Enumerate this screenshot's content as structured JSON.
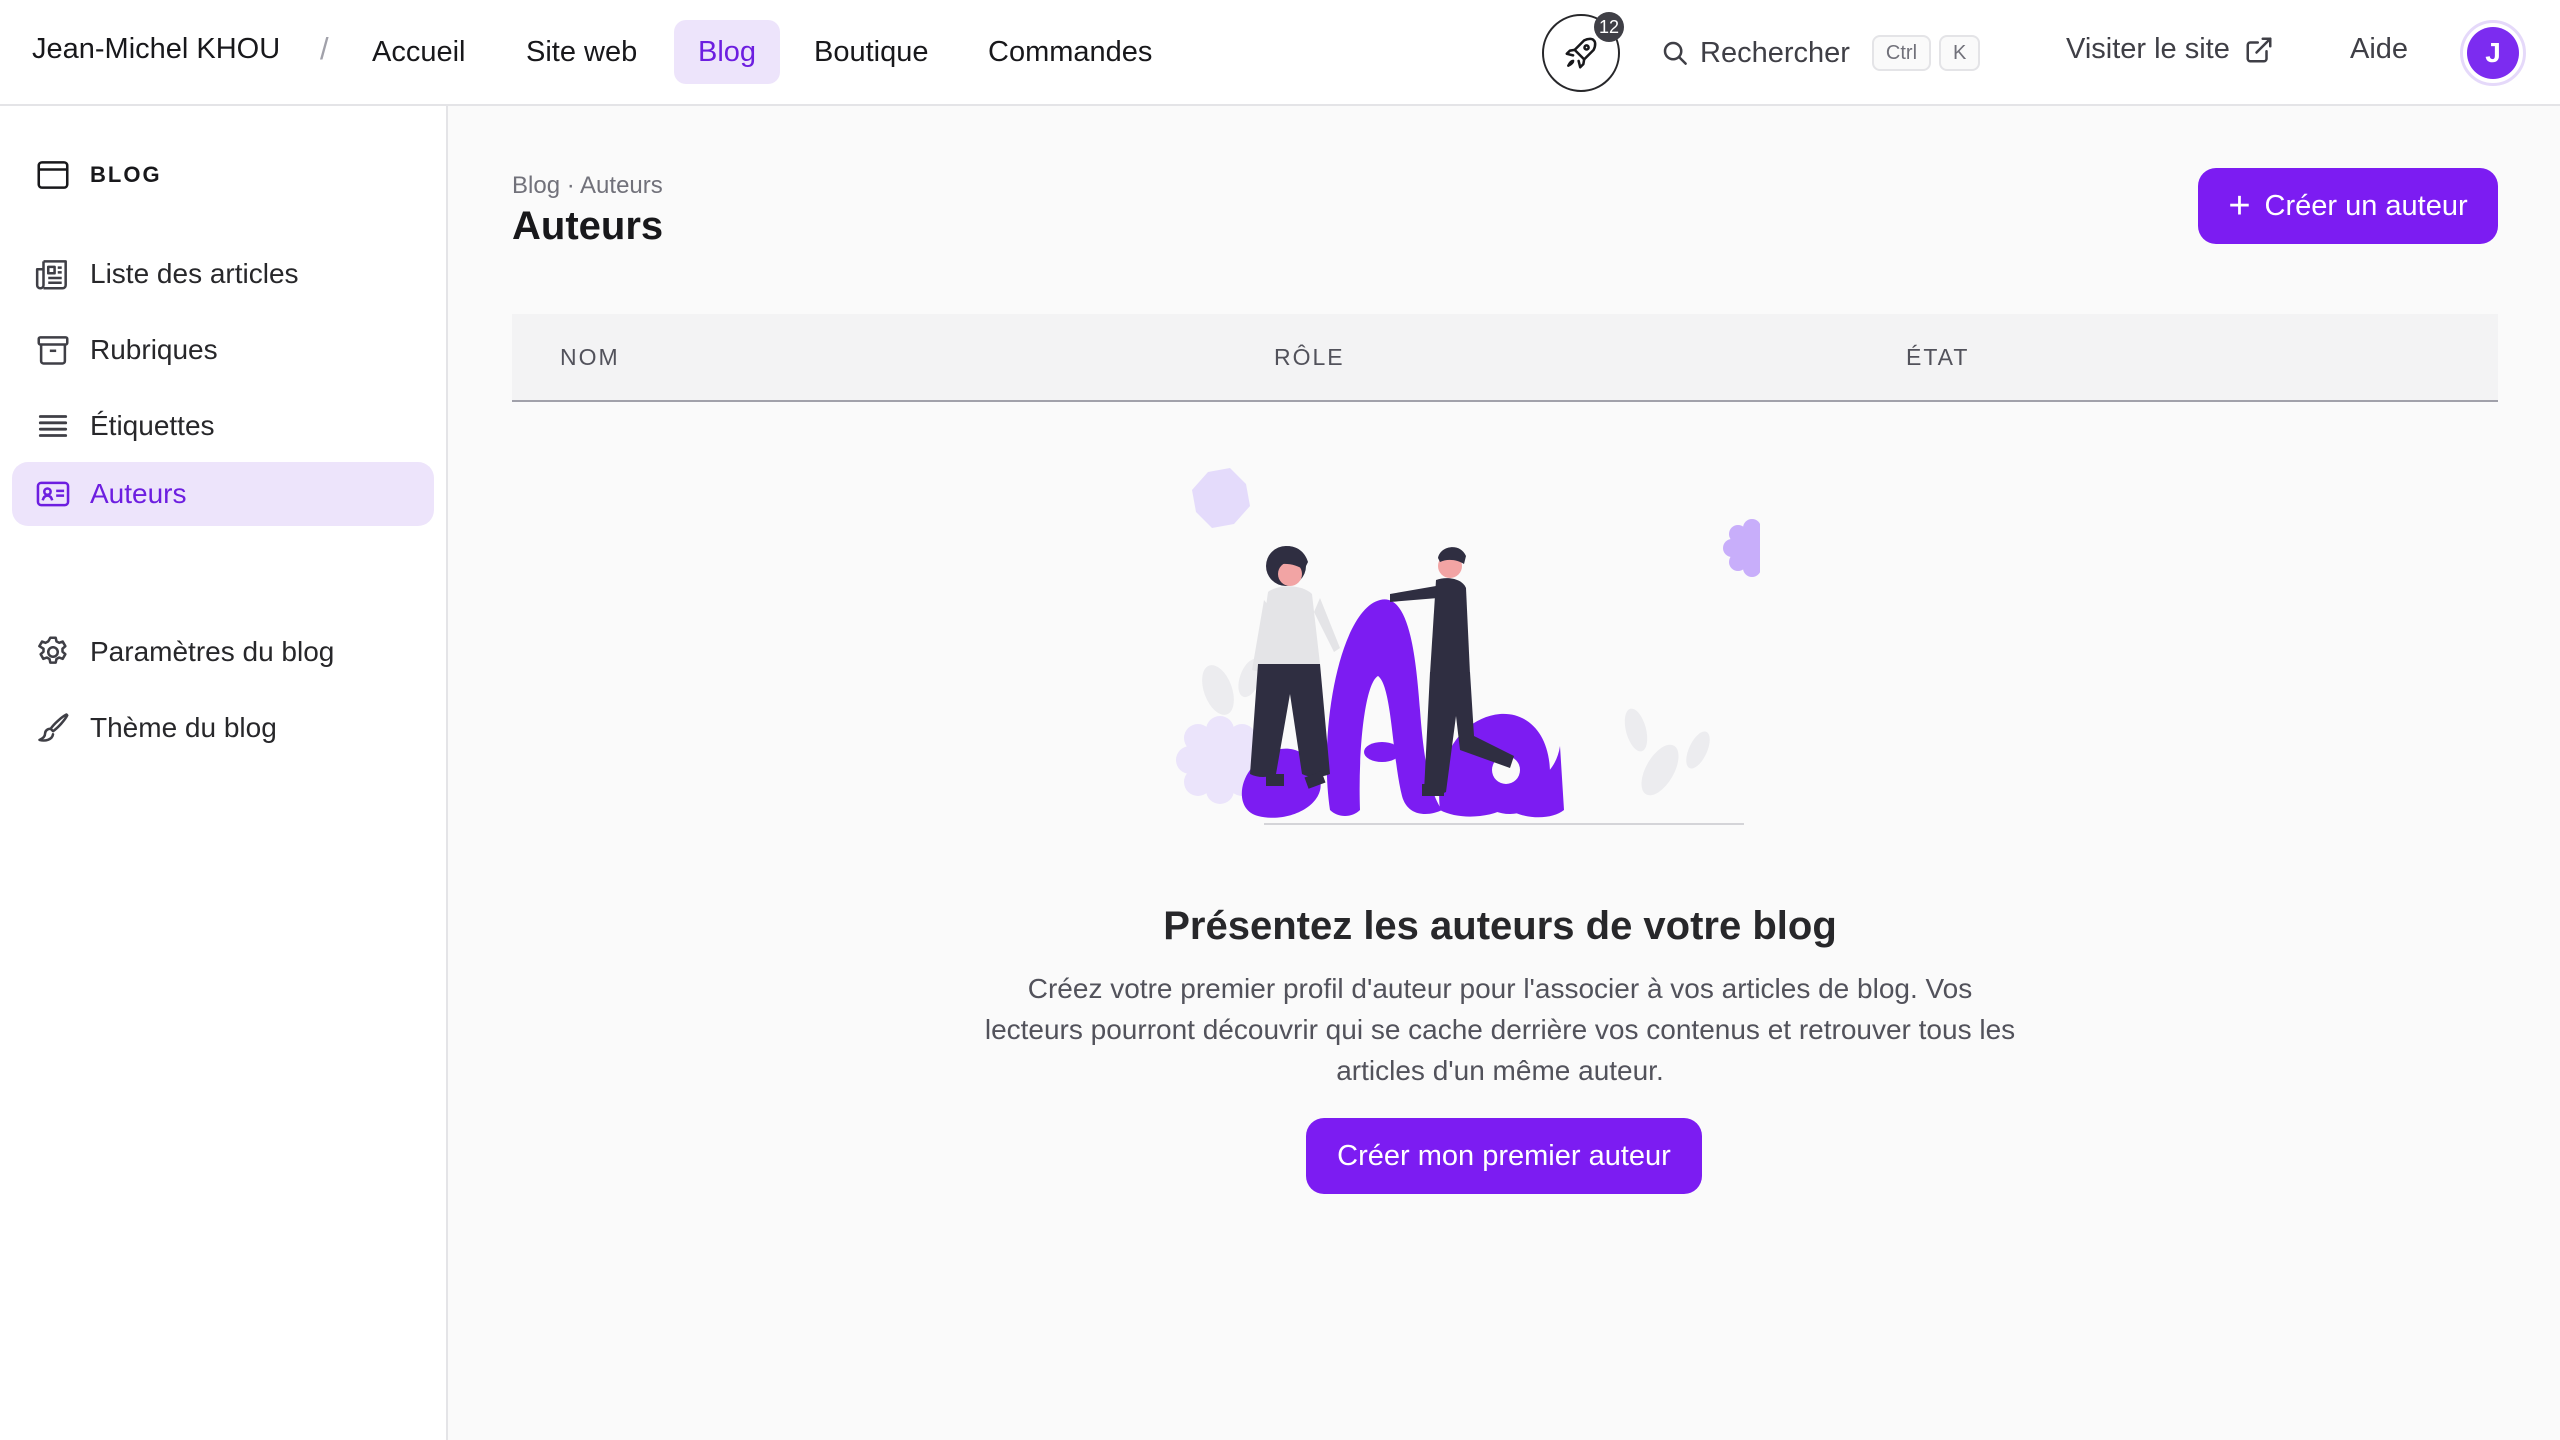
{
  "topbar": {
    "user": "Jean-Michel KHOU",
    "separator": "/",
    "nav": [
      "Accueil",
      "Site web",
      "Blog",
      "Boutique",
      "Commandes"
    ],
    "active_nav": "Blog",
    "notif_count": "12",
    "search_label": "Rechercher",
    "shortcut_keys": [
      "Ctrl",
      "K"
    ],
    "visit_label": "Visiter le site",
    "help_label": "Aide",
    "avatar_initial": "J"
  },
  "sidebar": {
    "section_title": "BLOG",
    "items": [
      {
        "label": "Liste des articles",
        "icon": "newspaper-icon"
      },
      {
        "label": "Rubriques",
        "icon": "archive-box-icon"
      },
      {
        "label": "Étiquettes",
        "icon": "list-lines-icon"
      },
      {
        "label": "Auteurs",
        "icon": "id-card-icon",
        "active": true
      },
      {
        "label": "Paramètres du blog",
        "icon": "gear-icon"
      },
      {
        "label": "Thème du blog",
        "icon": "paintbrush-icon"
      }
    ]
  },
  "main": {
    "breadcrumb": "Blog · Auteurs",
    "title": "Auteurs",
    "create_button": "Créer un auteur",
    "columns": [
      "NOM",
      "RÔLE",
      "ÉTAT"
    ],
    "empty_title": "Présentez les auteurs de votre blog",
    "empty_description": "Créez votre premier profil d'auteur pour l'associer à vos articles de blog. Vos lecteurs pourront découvrir qui se cache derrière vos contenus et retrouver tous les articles d'un même auteur.",
    "empty_button": "Créer mon premier auteur"
  },
  "colors": {
    "accent": "#7c1cf2",
    "accent_soft": "#ede4fb",
    "accent_text": "#6d1ee0"
  }
}
